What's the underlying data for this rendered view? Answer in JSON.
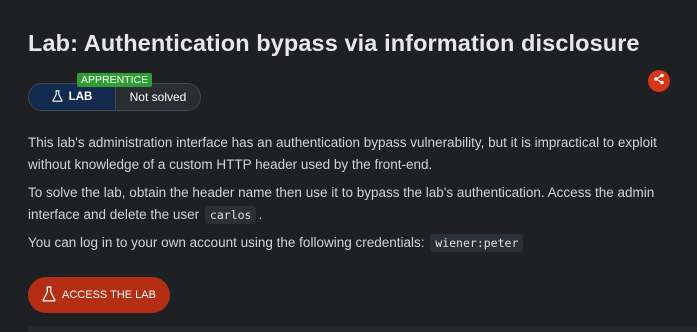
{
  "title": "Lab: Authentication bypass via information disclosure",
  "badge": {
    "level": "APPRENTICE",
    "lab_label": "LAB",
    "status": "Not solved"
  },
  "description": {
    "p1": "This lab's administration interface has an authentication bypass vulnerability, but it is impractical to exploit without knowledge of a custom HTTP header used by the front-end.",
    "p2_before": "To solve the lab, obtain the header name then use it to bypass the lab's authentication. Access the admin interface and delete the user",
    "p2_code": "carlos",
    "p2_after": ".",
    "p3_before": "You can log in to your own account using the following credentials:",
    "p3_code": "wiener:peter"
  },
  "access_button": {
    "label": "ACCESS THE LAB"
  },
  "icons": {
    "share": "share-icon",
    "flask": "flask-icon"
  },
  "colors": {
    "background": "#1e2023",
    "accent": "#b32e12",
    "share": "#d6371b",
    "level_badge": "#2d9d34",
    "lab_pill": "#122a4d"
  }
}
